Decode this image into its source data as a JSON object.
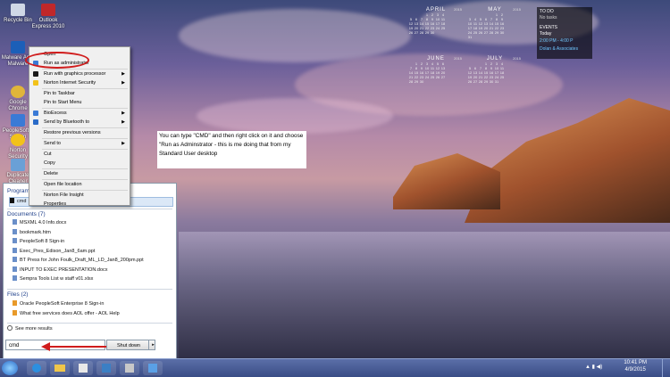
{
  "desktop_icons": [
    {
      "label": "Recycle Bin"
    },
    {
      "label": "Outlook Express 2010"
    },
    {
      "label": "Malware Anti-Malware"
    },
    {
      "label": "Google Chrome"
    },
    {
      "label": "PeopleSoft 8 Sign-in"
    },
    {
      "label": "Norton Security"
    },
    {
      "label": "Duplicate Cleaner"
    }
  ],
  "context_menu": {
    "items": [
      {
        "label": "Open",
        "arrow": ""
      },
      {
        "label": "Run as administrator",
        "arrow": ""
      },
      {
        "label": "Run with graphics processor",
        "arrow": "▶"
      },
      {
        "label": "Norton Internet Security",
        "arrow": "▶"
      },
      {
        "label": "Pin to Taskbar",
        "arrow": ""
      },
      {
        "label": "Pin to Start Menu",
        "arrow": ""
      },
      {
        "label": "BioExcess",
        "arrow": "▶"
      },
      {
        "label": "Send by Bluetooth to",
        "arrow": "▶"
      },
      {
        "label": "Restore previous versions",
        "arrow": ""
      },
      {
        "label": "Send to",
        "arrow": "▶"
      },
      {
        "label": "Cut",
        "arrow": ""
      },
      {
        "label": "Copy",
        "arrow": ""
      },
      {
        "label": "Delete",
        "arrow": ""
      },
      {
        "label": "Open file location",
        "arrow": ""
      },
      {
        "label": "Norton File Insight",
        "arrow": ""
      },
      {
        "label": "Properties",
        "arrow": ""
      }
    ]
  },
  "start_menu": {
    "programs_header": "Programs (1)",
    "program_item": "cmd",
    "documents_header": "Documents (7)",
    "documents": [
      "MSXML 4.0 Info.docx",
      "bookmark.htm",
      "PeopleSoft 8 Sign-in",
      "Exec_Pres_Edison_Jan8_6am.ppt",
      "BT Press for John Foulk_Draft_ML_LD_Jan8_200pm.ppt",
      "INPUT TO EXEC PRESENTATION.docx",
      "Sempra Tools List w staff v01.xlsx"
    ],
    "files_header": "Files (2)",
    "files": [
      "Oracle  PeopleSoft Enterprise 8 Sign-in",
      "What free services does AOL offer - AOL Help"
    ],
    "see_more": "See more results",
    "search_value": "cmd",
    "shutdown_label": "Shut down"
  },
  "annotation": "You can type \"CMD\" and then right click on it and choose \"Run as Adminstrator - this is me doing that from my Standard User desktop",
  "calendar": [
    {
      "month": "APRIL",
      "year": "2015",
      "rows": [
        [
          "",
          "",
          "",
          "1",
          "2",
          "3",
          "4"
        ],
        [
          "5",
          "6",
          "7",
          "8",
          "9",
          "10",
          "11"
        ],
        [
          "12",
          "13",
          "14",
          "15",
          "16",
          "17",
          "18"
        ],
        [
          "19",
          "20",
          "21",
          "22",
          "23",
          "24",
          "25"
        ],
        [
          "26",
          "27",
          "28",
          "29",
          "30",
          "",
          ""
        ]
      ]
    },
    {
      "month": "MAY",
      "year": "2015",
      "rows": [
        [
          "",
          "",
          "",
          "",
          "",
          "1",
          "2"
        ],
        [
          "3",
          "4",
          "5",
          "6",
          "7",
          "8",
          "9"
        ],
        [
          "10",
          "11",
          "12",
          "13",
          "14",
          "15",
          "16"
        ],
        [
          "17",
          "18",
          "19",
          "20",
          "21",
          "22",
          "23"
        ],
        [
          "24",
          "25",
          "26",
          "27",
          "28",
          "29",
          "30"
        ],
        [
          "31",
          "",
          "",
          "",
          "",
          "",
          ""
        ]
      ]
    },
    {
      "month": "JUNE",
      "year": "2015",
      "rows": [
        [
          "",
          "1",
          "2",
          "3",
          "4",
          "5",
          "6"
        ],
        [
          "7",
          "8",
          "9",
          "10",
          "11",
          "12",
          "13"
        ],
        [
          "14",
          "15",
          "16",
          "17",
          "18",
          "19",
          "20"
        ],
        [
          "21",
          "22",
          "23",
          "24",
          "25",
          "26",
          "27"
        ],
        [
          "28",
          "29",
          "30",
          "",
          "",
          "",
          ""
        ]
      ]
    },
    {
      "month": "JULY",
      "year": "2015",
      "rows": [
        [
          "",
          "",
          "",
          "1",
          "2",
          "3",
          "4"
        ],
        [
          "5",
          "6",
          "7",
          "8",
          "9",
          "10",
          "11"
        ],
        [
          "12",
          "13",
          "14",
          "15",
          "16",
          "17",
          "18"
        ],
        [
          "19",
          "20",
          "21",
          "22",
          "23",
          "24",
          "25"
        ],
        [
          "26",
          "27",
          "28",
          "29",
          "30",
          "31",
          ""
        ]
      ]
    }
  ],
  "gadget": {
    "todo_title": "TO DO",
    "todo_value": "No tasks",
    "events_title": "EVENTS",
    "events_day": "Today",
    "event_time": "2:00 PM - 4:00 P",
    "event_name": "Dolan & Associates"
  },
  "clock": {
    "time": "10:41 PM",
    "date": "4/9/2015"
  },
  "colors": {
    "highlight": "#d01c1c",
    "taskbar": "#3a4d86"
  }
}
